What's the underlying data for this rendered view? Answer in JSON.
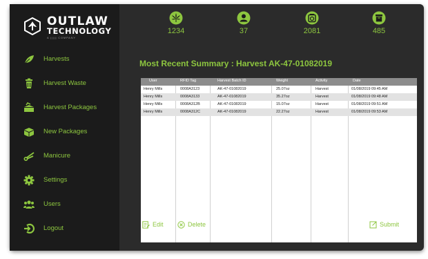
{
  "brand": {
    "title": "OUTLAW",
    "subtitle": "TECHNOLOGY",
    "tagline": "A ||||| COMPANY"
  },
  "colors": {
    "accent": "#8dc63f",
    "sidebar": "#1b1b1b",
    "panel": "#2b2b2b"
  },
  "stats": [
    {
      "icon": "cannabis-leaf-icon",
      "value": "1234"
    },
    {
      "icon": "user-icon",
      "value": "37"
    },
    {
      "icon": "scale-icon",
      "value": "2081"
    },
    {
      "icon": "box-icon",
      "value": "485"
    }
  ],
  "nav": {
    "items": [
      {
        "icon": "leaf-icon",
        "label": "Harvests"
      },
      {
        "icon": "trash-icon",
        "label": "Harvest Waste"
      },
      {
        "icon": "package-icon",
        "label": "Harvest Packages"
      },
      {
        "icon": "gift-box-icon",
        "label": "New Packages"
      },
      {
        "icon": "scissors-icon",
        "label": "Manicure"
      },
      {
        "icon": "gear-icon",
        "label": "Settings"
      },
      {
        "icon": "users-icon",
        "label": "Users"
      },
      {
        "icon": "logout-icon",
        "label": "Logout"
      }
    ]
  },
  "summary": {
    "title": "Most Recent Summary : Harvest AK-47-01082019"
  },
  "table": {
    "headers": [
      "User",
      "RFID Tag",
      "Harvest Batch ID",
      "Weight",
      "Activity",
      "Date"
    ],
    "rows": [
      [
        "Henry Mills",
        "0008A3123",
        "AK-47-01082019",
        "25.07oz",
        "Harvest",
        "01/08/2019  09:45 AM"
      ],
      [
        "Henry Mills",
        "0008A3133",
        "AK-47-01082019",
        "35.27oz",
        "Harvest",
        "01/08/2019  09:48 AM"
      ],
      [
        "Henry Mills",
        "0008A312B",
        "AK-47-01082019",
        "15.07oz",
        "Harvest",
        "01/08/2019  09:51 AM"
      ],
      [
        "Henry Mills",
        "0008A312C",
        "AK-47-01082019",
        "22.27oz",
        "Harvest",
        "01/08/2019  09:53 AM"
      ]
    ]
  },
  "actions": {
    "edit": "Edit",
    "delete": "Delete",
    "submit": "Submit"
  }
}
